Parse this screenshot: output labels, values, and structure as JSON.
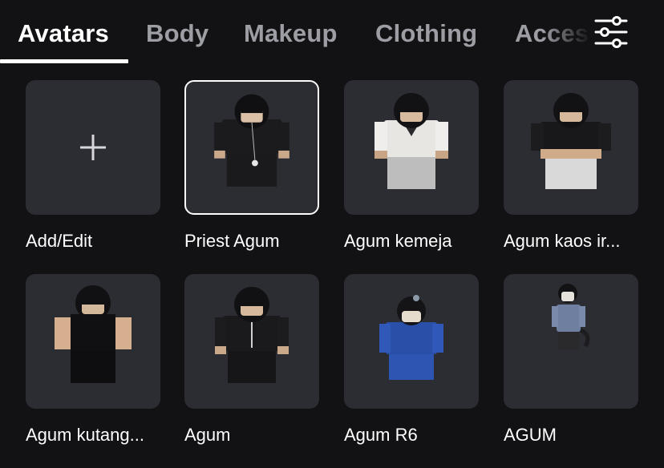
{
  "tabs": [
    {
      "label": "Avatars",
      "active": true
    },
    {
      "label": "Body",
      "active": false
    },
    {
      "label": "Makeup",
      "active": false
    },
    {
      "label": "Clothing",
      "active": false
    },
    {
      "label": "Accessories",
      "active": false
    }
  ],
  "filter_icon": "sliders-icon",
  "colors": {
    "background": "#121215",
    "tile": "#2c2d33",
    "inactive_tab": "#9d9ea4",
    "text": "#ffffff"
  },
  "avatars": [
    {
      "label": "Add/Edit",
      "icon": "plus-icon",
      "selected": false
    },
    {
      "label": "Priest Agum",
      "selected": true
    },
    {
      "label": "Agum kemeja",
      "selected": false
    },
    {
      "label": "Agum kaos ir...",
      "selected": false
    },
    {
      "label": "Agum kutang...",
      "selected": false
    },
    {
      "label": "Agum",
      "selected": false
    },
    {
      "label": "Agum R6",
      "selected": false
    },
    {
      "label": "AGUM",
      "selected": false
    }
  ]
}
